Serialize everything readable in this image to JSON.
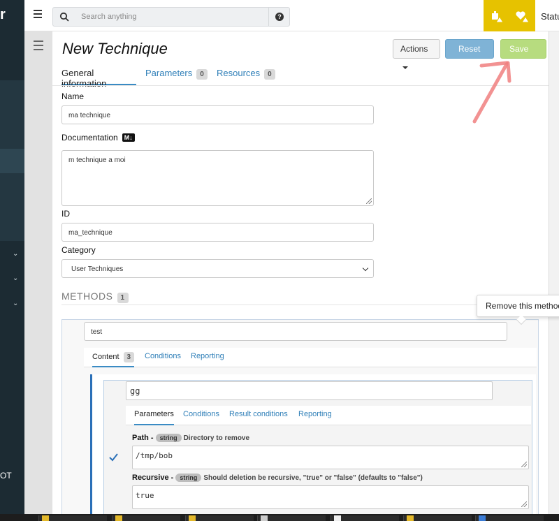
{
  "sidebar": {
    "logo_fragment": "r",
    "bottom_fragment": "OT",
    "chevrons": [
      "chevron",
      "chevron",
      "chevron"
    ]
  },
  "topbar": {
    "search_placeholder": "Search anything",
    "status_label": "Statu",
    "alert_color": "#e6c200"
  },
  "page": {
    "title": "New Technique",
    "actions_label": "Actions",
    "reset_label": "Reset",
    "save_label": "Save",
    "tabs": [
      {
        "label": "General information"
      },
      {
        "label": "Parameters",
        "count": "0"
      },
      {
        "label": "Resources",
        "count": "0"
      }
    ]
  },
  "form": {
    "name_label": "Name",
    "name_value": "ma technique",
    "doc_label": "Documentation",
    "doc_md_badge": "M↓",
    "doc_value": "m technique a moi",
    "id_label": "ID",
    "id_value": "ma_technique",
    "category_label": "Category",
    "category_value": "User Techniques"
  },
  "methods": {
    "title": "METHODS",
    "count": "1",
    "tooltip": "Remove this method",
    "item": {
      "name": "test",
      "tabs": [
        {
          "label": "Content",
          "count": "3"
        },
        {
          "label": "Conditions"
        },
        {
          "label": "Reporting"
        }
      ],
      "inner": {
        "name": "gg",
        "tabs": [
          {
            "label": "Parameters"
          },
          {
            "label": "Conditions"
          },
          {
            "label": "Result conditions"
          },
          {
            "label": "Reporting"
          }
        ],
        "params": [
          {
            "name": "Path -",
            "type": "string",
            "desc": "Directory to remove",
            "value": "/tmp/bob"
          },
          {
            "name": "Recursive -",
            "type": "string",
            "desc": "Should deletion be recursive, \"true\" or \"false\" (defaults to \"false\")",
            "value": "true"
          }
        ]
      }
    }
  },
  "colors": {
    "accent": "#2f7fb8",
    "reset_bg": "#7fb3d6",
    "save_bg": "#b7dc7f",
    "annotation_arrow": "#f08080"
  }
}
